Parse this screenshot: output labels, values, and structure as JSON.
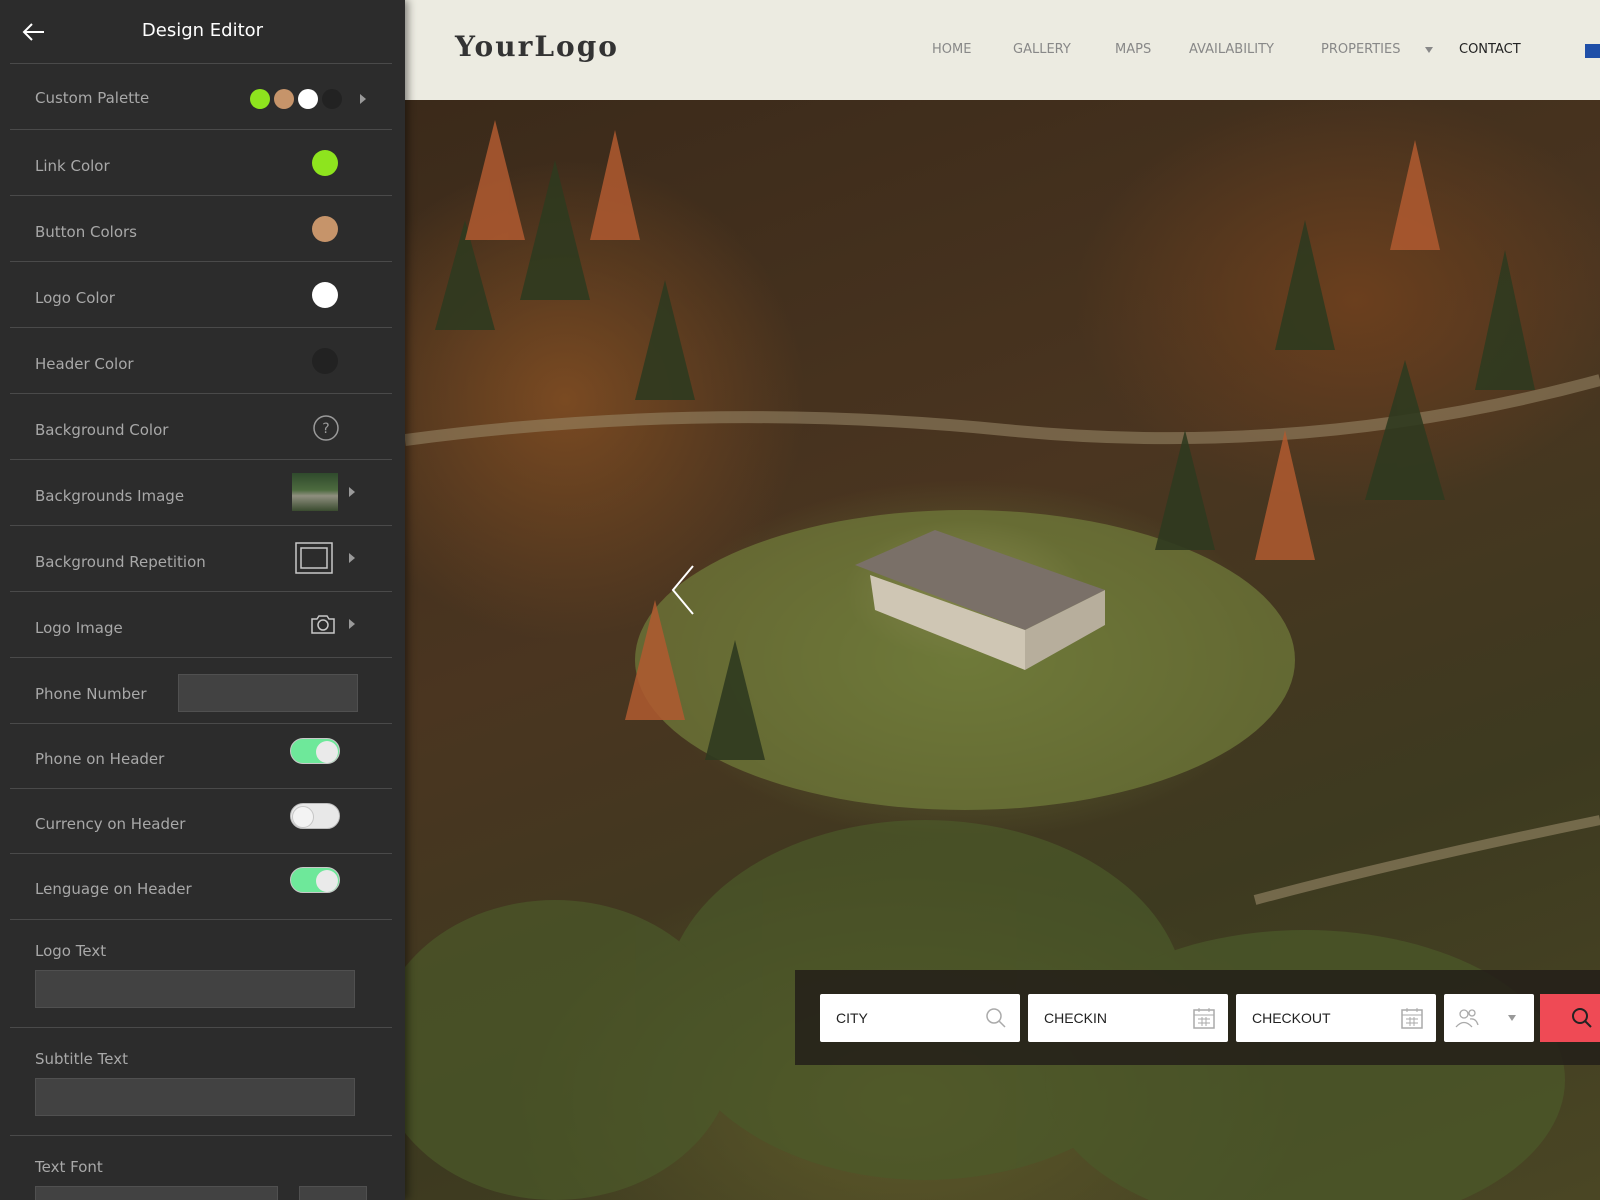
{
  "sidebar": {
    "title": "Design Editor",
    "rows": {
      "custom_palette": {
        "label": "Custom Palette",
        "colors": [
          "#8ee41e",
          "#c6946a",
          "#ffffff",
          "#222222"
        ]
      },
      "link_color": {
        "label": "Link Color",
        "color": "#8ee41e"
      },
      "button_colors": {
        "label": "Button Colors",
        "color": "#c6946a"
      },
      "logo_color": {
        "label": "Logo Color",
        "color": "#ffffff"
      },
      "header_color": {
        "label": "Header Color",
        "color": "#222222"
      },
      "background_color": {
        "label": "Background Color",
        "icon": "question-icon"
      },
      "backgrounds_image": {
        "label": "Backgrounds Image",
        "icon": "image-thumbnail"
      },
      "background_repetition": {
        "label": "Background Repetition",
        "icon": "frame-icon"
      },
      "logo_image": {
        "label": "Logo Image",
        "icon": "camera-icon"
      },
      "phone_number": {
        "label": "Phone Number",
        "value": ""
      },
      "phone_on_header": {
        "label": "Phone on Header",
        "on": true
      },
      "currency_on_header": {
        "label": "Currency on Header",
        "on": false
      },
      "language_on_header": {
        "label": "Lenguage on Header",
        "on": true
      },
      "logo_text": {
        "label": "Logo Text",
        "value": ""
      },
      "subtitle_text": {
        "label": "Subtitle Text",
        "value": ""
      },
      "text_font": {
        "label": "Text Font",
        "value": ""
      }
    }
  },
  "site": {
    "logo": "YourLogo",
    "nav": [
      "HOME",
      "GALLERY",
      "MAPS",
      "AVAILABILITY",
      "PROPERTIES",
      "CONTACT"
    ],
    "active_nav": "CONTACT",
    "search": {
      "city": "CITY",
      "checkin": "CHECKIN",
      "checkout": "CHECKOUT"
    }
  },
  "colors": {
    "toggle_on": "#6ee89a",
    "search_button": "#ef4a55",
    "header_bg": "#ecebe1"
  }
}
